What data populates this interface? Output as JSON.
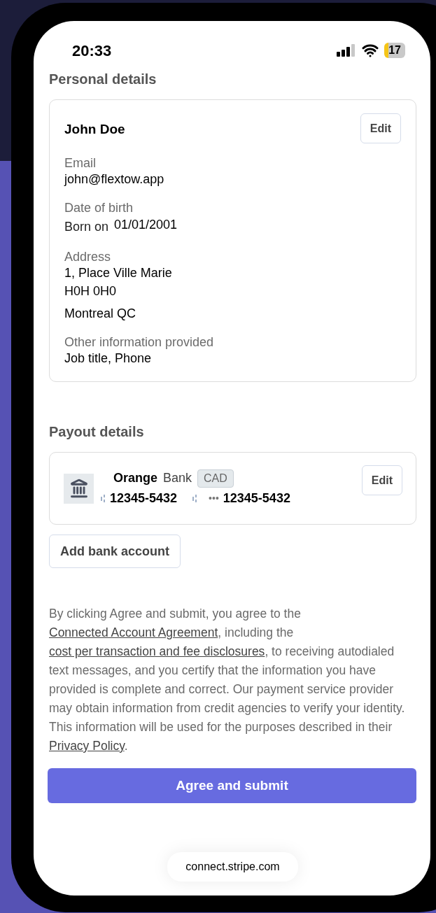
{
  "status_bar": {
    "time": "20:33",
    "battery": "17",
    "battery_low": true
  },
  "personal": {
    "heading": "Personal details",
    "name": "John Doe",
    "edit": "Edit",
    "fields": [
      {
        "label": "Email",
        "lines": [
          "john@flextow.app"
        ]
      },
      {
        "label": "Date of birth",
        "lines": [
          "Born on",
          "01/01/2001"
        ],
        "kind": "inline"
      },
      {
        "label": "Address",
        "lines": [
          "1, Place Ville Marie",
          "H0H 0H0",
          "Montreal QC"
        ],
        "kind": "address"
      },
      {
        "label": "Other information provided",
        "lines": [
          "Job title, Phone"
        ]
      }
    ]
  },
  "payout": {
    "heading": "Payout details",
    "bank_name": "Orange",
    "bank_label": "Bank",
    "currency": "CAD",
    "routing": "12345-5432",
    "mask": "•••",
    "account": "12345-5432",
    "edit": "Edit",
    "add_button": "Add bank account"
  },
  "consent": [
    {
      "text": "By clicking Agree and submit, you agree to the ",
      "kind": "text"
    },
    {
      "text": "Connected Account Agreement",
      "kind": "link"
    },
    {
      "text": ", including the ",
      "kind": "text"
    },
    {
      "text": "cost per transaction and fee disclosures",
      "kind": "link"
    },
    {
      "text": ", to receiving autodialed text messages, and you certify that the information you have provided is complete and correct. Our payment service provider may obtain information from credit agencies to verify your identity. This information will be used for the purposes described in their ",
      "kind": "text"
    },
    {
      "text": "Privacy Policy",
      "kind": "link"
    },
    {
      "text": ".",
      "kind": "text"
    }
  ],
  "submit": "Agree and submit",
  "url": "connect.stripe.com"
}
